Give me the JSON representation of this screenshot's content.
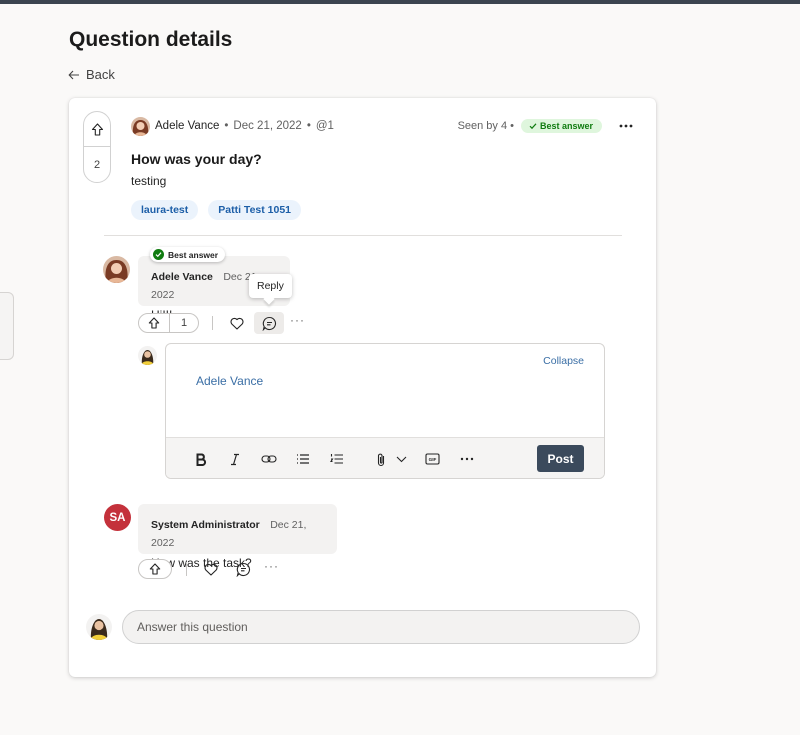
{
  "page": {
    "title": "Question details",
    "back_label": "Back"
  },
  "question": {
    "author": "Adele Vance",
    "date": "Dec 21, 2022",
    "mention_count": "@1",
    "seen_by": "Seen by 4",
    "best_answer_badge": "Best answer",
    "title": "How was your day?",
    "body": "testing",
    "vote_count": "2",
    "tags": [
      "laura-test",
      "Patti Test 1051"
    ]
  },
  "replies": [
    {
      "author": "Adele Vance",
      "date": "Dec 21, 2022",
      "text": "Hi!!!",
      "best_label": "Best answer",
      "vote_count": "1",
      "tooltip": "Reply"
    },
    {
      "author": "System Administrator",
      "initials": "SA",
      "date": "Dec 21, 2022",
      "text": "How was the task?"
    }
  ],
  "editor": {
    "collapse_label": "Collapse",
    "mention": "Adele Vance",
    "post_label": "Post"
  },
  "answer_box": {
    "placeholder": "Answer this question"
  },
  "colors": {
    "accent": "#3b4a5c",
    "link": "#3a6ea5",
    "best_green": "#107c10",
    "avatar_sa": "#c4313b"
  }
}
